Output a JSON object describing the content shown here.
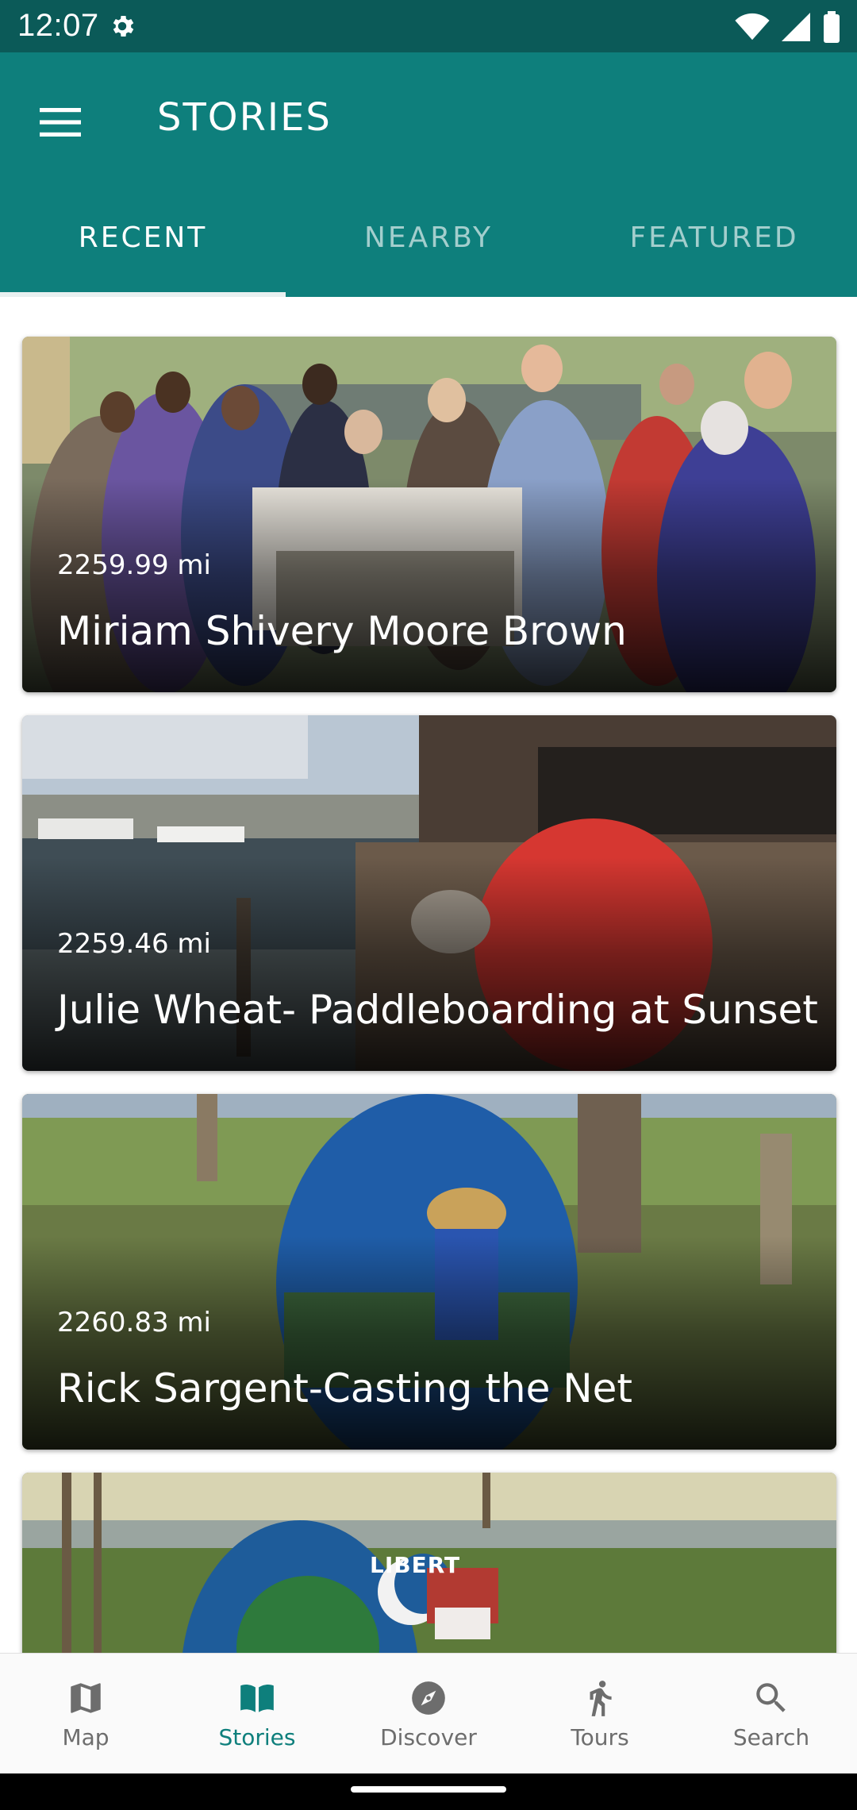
{
  "status": {
    "time": "12:07"
  },
  "appbar": {
    "title": "STORIES"
  },
  "tabs": [
    {
      "label": "RECENT",
      "active": true
    },
    {
      "label": "NEARBY",
      "active": false
    },
    {
      "label": "FEATURED",
      "active": false
    }
  ],
  "stories": [
    {
      "distance": "2259.99 mi",
      "title": "Miriam Shivery Moore Brown"
    },
    {
      "distance": "2259.46 mi",
      "title": "Julie Wheat- Paddleboarding at Sunset"
    },
    {
      "distance": "2260.83 mi",
      "title": "Rick Sargent-Casting the Net"
    },
    {
      "distance": "",
      "title": "",
      "image_text": "LIBERT"
    }
  ],
  "bottom_nav": [
    {
      "label": "Map",
      "icon": "map-icon"
    },
    {
      "label": "Stories",
      "icon": "book-icon",
      "active": true
    },
    {
      "label": "Discover",
      "icon": "compass-icon"
    },
    {
      "label": "Tours",
      "icon": "walking-icon"
    },
    {
      "label": "Search",
      "icon": "search-icon"
    }
  ],
  "colors": {
    "primary": "#0e7f7c",
    "status_bar": "#0b5a58",
    "nav_active": "#0e7f7c",
    "nav_inactive": "#6d6d6d"
  }
}
